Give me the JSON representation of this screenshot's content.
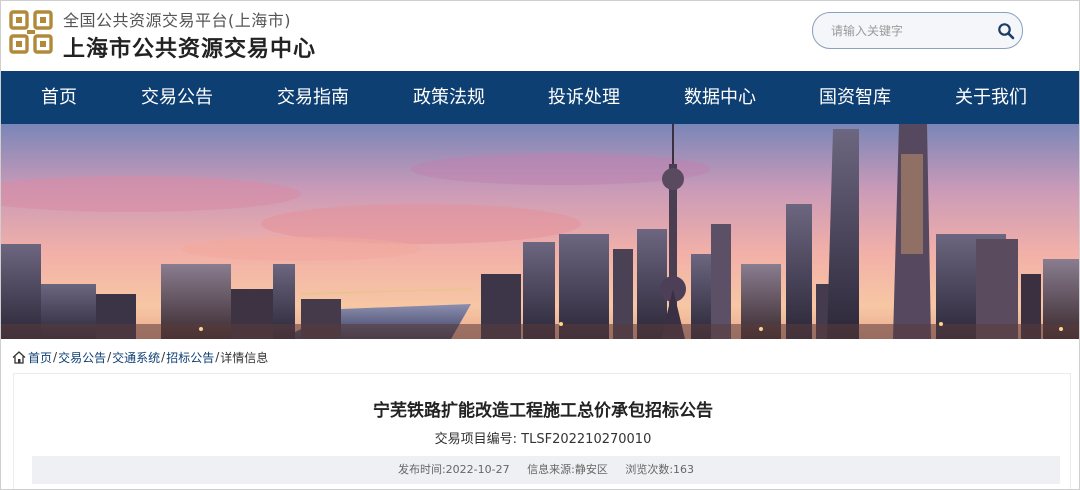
{
  "header": {
    "site_subtitle": "全国公共资源交易平台(上海市)",
    "site_title": "上海市公共资源交易中心",
    "search_placeholder": "请输入关键字",
    "brand_color": "#0e3f73",
    "logo_color": "#b08a3a"
  },
  "nav": {
    "items": [
      "首页",
      "交易公告",
      "交易指南",
      "政策法规",
      "投诉处理",
      "数据中心",
      "国资智库",
      "关于我们"
    ]
  },
  "breadcrumb": {
    "items": [
      "首页",
      "交易公告",
      "交通系统",
      "招标公告"
    ],
    "current": "详情信息",
    "separator": "/"
  },
  "article": {
    "title": "宁芜铁路扩能改造工程施工总价承包招标公告",
    "project_code_label": "交易项目编号:",
    "project_code": "TLSF202210270010",
    "publish_label": "发布时间:",
    "publish_date": "2022-10-27",
    "source_label": "信息来源:",
    "source": "静安区",
    "views_label": "浏览次数:",
    "views": "163"
  }
}
